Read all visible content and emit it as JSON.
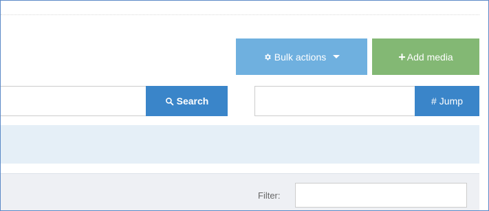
{
  "toolbar": {
    "bulk_actions_label": "Bulk actions",
    "add_media_label": "Add media"
  },
  "search": {
    "placeholder": "",
    "button_label": "Search"
  },
  "jump": {
    "placeholder": "",
    "button_label": "Jump"
  },
  "filter": {
    "label": "Filter:",
    "placeholder": ""
  },
  "colors": {
    "bulk_button": "#6fb0df",
    "add_button": "#83b874",
    "primary_button": "#3a85c9",
    "info_band": "#e5eff7",
    "filter_band": "#eef0f4"
  },
  "icons": {
    "bulk": "gear-icon",
    "add": "plus-icon",
    "search": "search-icon",
    "jump": "hash-icon",
    "dropdown": "caret-down-icon"
  }
}
